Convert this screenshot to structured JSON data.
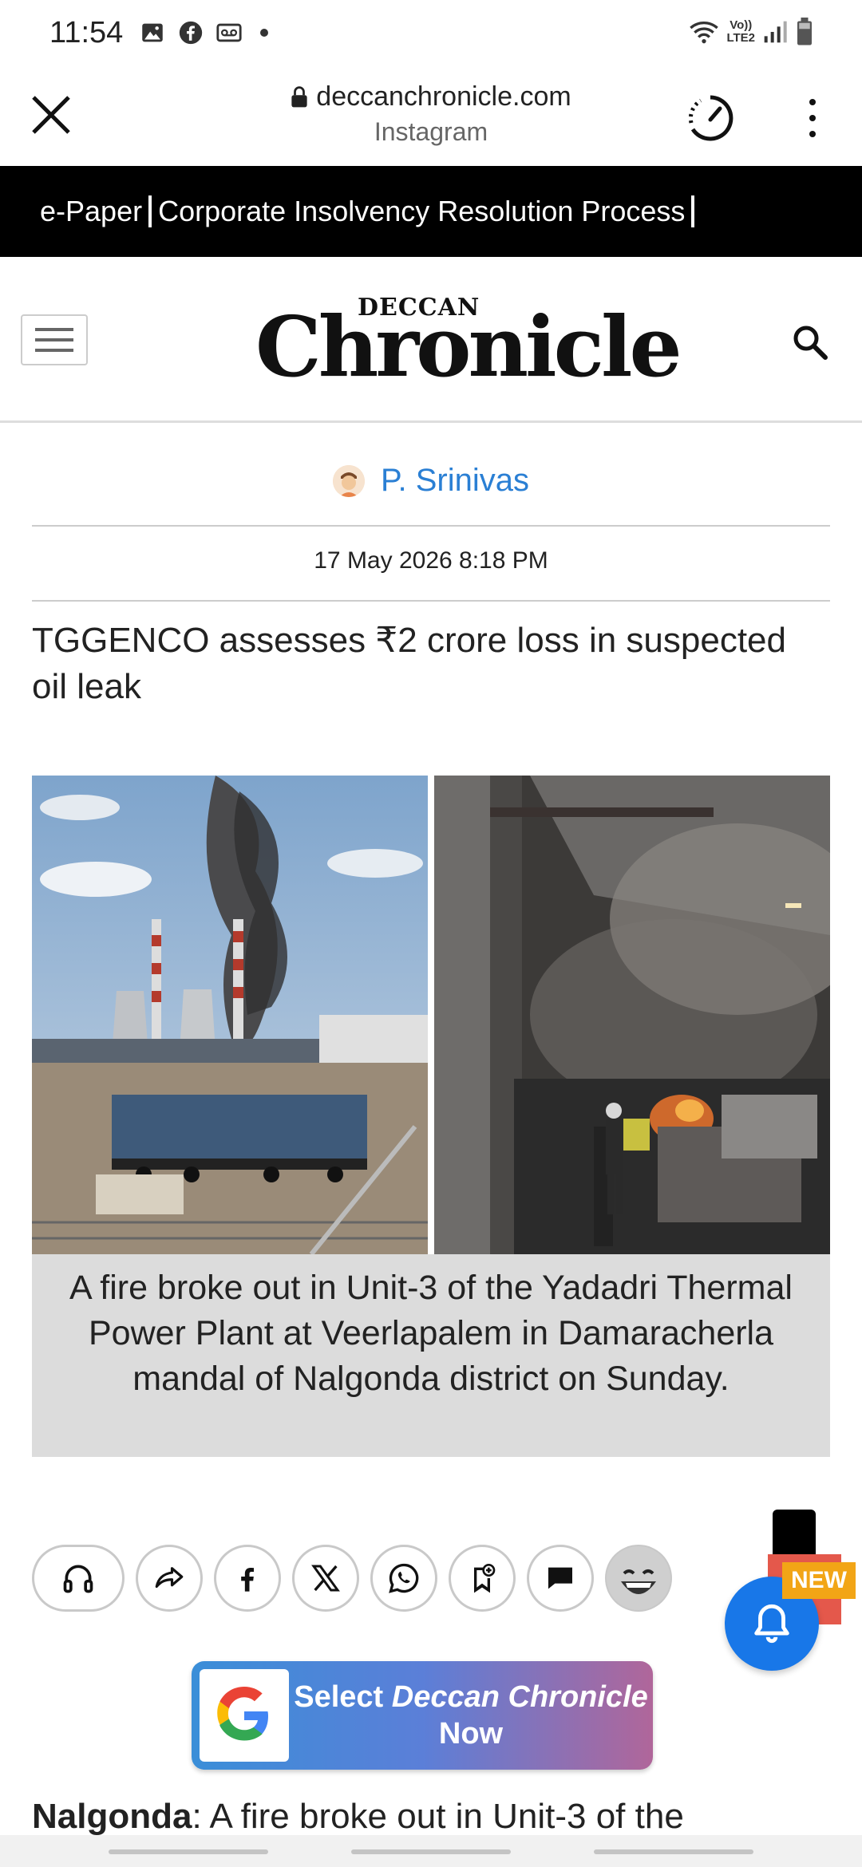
{
  "status_bar": {
    "time": "11:54",
    "icons": [
      "gallery-icon",
      "facebook-icon",
      "voicemail-icon",
      "wifi-icon",
      "volte-icon",
      "signal-icon",
      "battery-icon"
    ],
    "network_label_top": "Vo))",
    "network_label_bottom": "LTE2"
  },
  "browser": {
    "url": "deccanchronicle.com",
    "subtitle": "Instagram"
  },
  "banner": {
    "items": [
      "e-Paper",
      "Corporate Insolvency Resolution Process"
    ]
  },
  "site_header": {
    "logo_small": "DECCAN",
    "logo_big": "Chronicle"
  },
  "article": {
    "author": "P. Srinivas",
    "date": "17 May 2026 8:18 PM",
    "headline": "TGGENCO assesses ₹2 crore loss in suspected oil leak",
    "caption": "A fire broke out in Unit-3 of the Yadadri Thermal Power Plant at Veerlapalem in Damaracherla mandal of Nalgonda district on Sunday.",
    "body_lead": "Nalgonda",
    "body_text": ": A fire broke out in Unit-3 of the"
  },
  "share": {
    "buttons": [
      "headphones-icon",
      "share-icon",
      "facebook-icon",
      "x-icon",
      "whatsapp-icon",
      "bookmark-add-icon",
      "comment-icon",
      "emoji-icon"
    ]
  },
  "notification": {
    "badge": "NEW"
  },
  "google_pill": {
    "line1_prefix": "Select ",
    "line1_brand": "Deccan Chronicle",
    "line2": "Now"
  },
  "colors": {
    "accent_blue": "#2a7fd4",
    "bell_blue": "#1877e8",
    "banner_bg": "#000000",
    "new_badge": "#f2a516"
  }
}
